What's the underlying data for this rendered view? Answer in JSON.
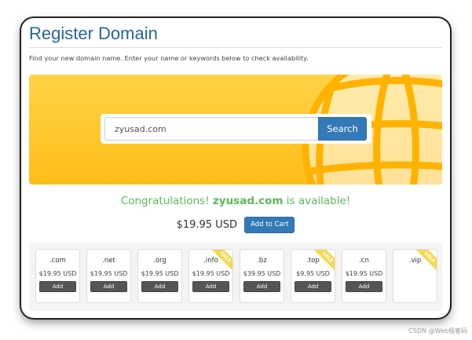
{
  "page": {
    "title": "Register Domain",
    "subtitle": "Find your new domain name. Enter your name or keywords below to check availability."
  },
  "search": {
    "value": "zyusad.com",
    "button_label": "Search"
  },
  "result": {
    "prefix": "Congratulations! ",
    "domain": "zyusad.com",
    "suffix": " is available!",
    "price": "$19.95 USD",
    "cart_label": "Add to Cart"
  },
  "tlds": [
    {
      "ext": ".com",
      "price": "$19.95 USD",
      "add": "Add",
      "sale": false
    },
    {
      "ext": ".net",
      "price": "$19.95 USD",
      "add": "Add",
      "sale": false
    },
    {
      "ext": ".org",
      "price": "$19.95 USD",
      "add": "Add",
      "sale": false
    },
    {
      "ext": ".info",
      "price": "$19.95 USD",
      "add": "Add",
      "sale": true,
      "sale_label": "SALE"
    },
    {
      "ext": ".bz",
      "price": "$39.95 USD",
      "add": "Add",
      "sale": false
    },
    {
      "ext": ".top",
      "price": "$9.95 USD",
      "add": "Add",
      "sale": true,
      "sale_label": "SALE"
    },
    {
      "ext": ".cn",
      "price": "$19.95 USD",
      "add": "Add",
      "sale": false
    },
    {
      "ext": ".vip",
      "sale": true,
      "sale_label": "SALE"
    }
  ],
  "watermark": "CSDN @Web极客码",
  "colors": {
    "brand_blue": "#337ab7",
    "title_blue": "#2a6496",
    "success_green": "#5cb85c",
    "hero_yellow": "#ffc82b",
    "sale_ribbon": "#f5d94e"
  },
  "icons": {
    "hero": "globe-icon"
  }
}
